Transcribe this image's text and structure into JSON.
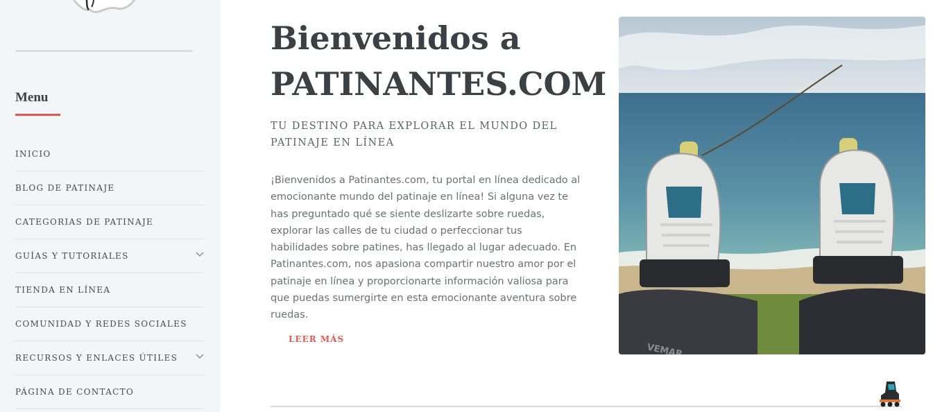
{
  "sidebar": {
    "menu_title": "Menu",
    "items": [
      {
        "label": "INICIO",
        "has_submenu": false
      },
      {
        "label": "BLOG DE PATINAJE",
        "has_submenu": false
      },
      {
        "label": "CATEGORIAS DE PATINAJE",
        "has_submenu": false
      },
      {
        "label": "GUÍAS Y TUTORIALES",
        "has_submenu": true
      },
      {
        "label": "TIENDA EN LÍNEA",
        "has_submenu": false
      },
      {
        "label": "COMUNIDAD Y REDES SOCIALES",
        "has_submenu": false
      },
      {
        "label": "RECURSOS Y ENLACES ÚTILES",
        "has_submenu": true
      },
      {
        "label": "PÁGINA DE CONTACTO",
        "has_submenu": false
      }
    ]
  },
  "main": {
    "title": "Bienvenidos a PATINANTES.COM",
    "subtitle": "TU DESTINO PARA EXPLORAR EL MUNDO DEL PATINAJE EN LÍNEA",
    "intro": "¡Bienvenidos a Patinantes.com, tu portal en línea dedicado al emocionante mundo del patinaje en línea! Si alguna vez te has preguntado qué se siente deslizarte sobre ruedas, explorar las calles de tu ciudad o perfeccionar tus habilidades sobre patines, has llegado al lugar adecuado. En Patinantes.com, nos apasiona compartir nuestro amor por el patinaje en línea y proporcionarte información valiosa para que puedas sumergirte en esta emocionante aventura sobre ruedas.",
    "read_more": "LEER MÁS",
    "hero_brand_text": "VEMAR"
  },
  "colors": {
    "accent": "#e05a55",
    "sidebar_bg": "#f4f5f7",
    "heading": "#3b4045"
  },
  "icons": {
    "submenu": "chevron-down-icon",
    "floating": "inline-skate-icon"
  }
}
